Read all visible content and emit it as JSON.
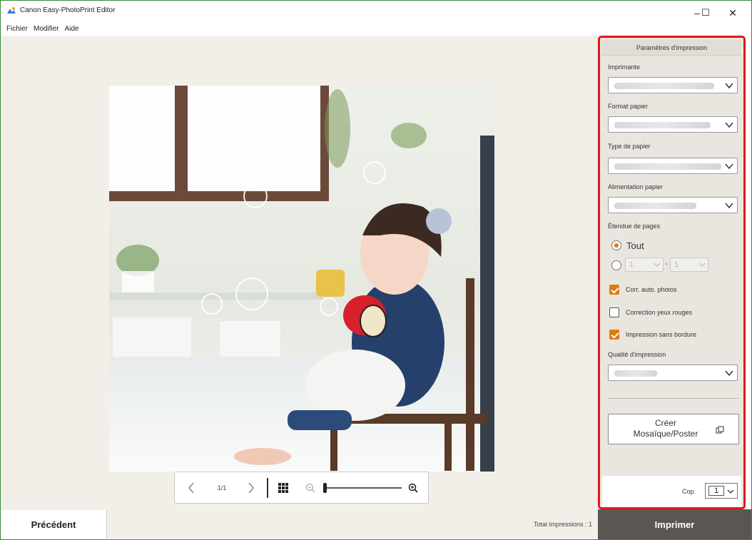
{
  "window": {
    "title": "Canon Easy-PhotoPrint Editor",
    "controls": {
      "minimize": "–",
      "maximize": "☐",
      "close": "✕"
    }
  },
  "menu": [
    "Fichier",
    "Modifier",
    "Aide"
  ],
  "preview": {
    "page_indicator": "1/1",
    "zoom_level": 0.0
  },
  "panel": {
    "header": "Paramètres d'impression",
    "printer_label": "Imprimante",
    "paper_size_label": "Format papier",
    "paper_type_label": "Type de papier",
    "paper_source_label": "Alimentation papier",
    "page_range_label": "Étendue de pages",
    "range_all_label": "Tout",
    "range_from_value": "1",
    "range_to_value": "1",
    "range_dash": "-",
    "auto_photo_fix_label": "Corr. auto. photos",
    "auto_photo_fix_checked": true,
    "red_eye_label": "Correction yeux rouges",
    "red_eye_checked": false,
    "borderless_label": "Impression sans bordure",
    "borderless_checked": true,
    "quality_label": "Qualité d'impression",
    "create_button_line1": "Créer",
    "create_button_line2": "Mosaïque/Poster",
    "copies_label": "Cop.",
    "copies_value": "1"
  },
  "footer": {
    "previous_label": "Précédent",
    "total_prints": "Total impressions : 1",
    "print_label": "Imprimer"
  },
  "colors": {
    "accent_orange": "#e07a10",
    "highlight_red": "#e3161b",
    "print_button": "#5a5752",
    "workspace": "#f2efe9"
  }
}
